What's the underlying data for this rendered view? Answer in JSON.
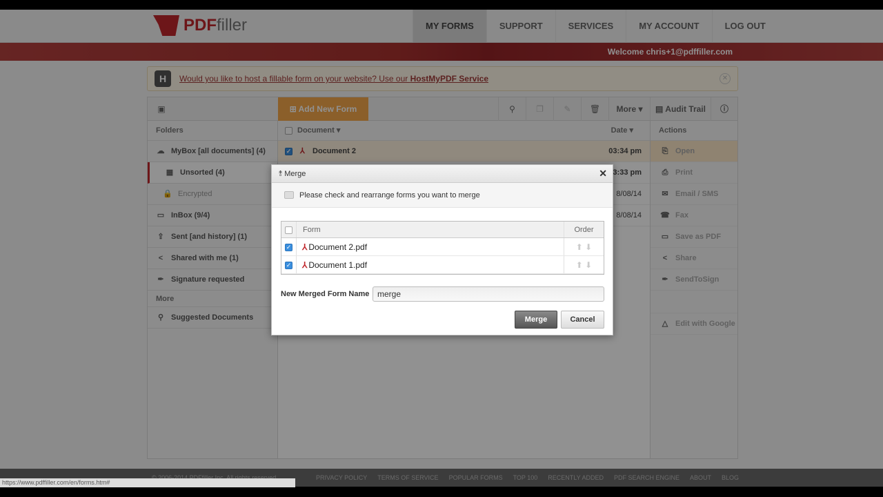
{
  "header": {
    "logo": "PDFfiller",
    "nav": [
      "MY FORMS",
      "SUPPORT",
      "SERVICES",
      "MY ACCOUNT",
      "LOG OUT"
    ],
    "welcome": "Welcome chris+1@pdffiller.com"
  },
  "banner": {
    "text": "Would you like to host a fillable form on your website? Use our ",
    "link": "HostMyPDF Service"
  },
  "toolbar": {
    "add_new_form": "Add New Form",
    "more": "More ▾",
    "audit_trail": "Audit Trail"
  },
  "sidebar": {
    "header": "Folders",
    "items": [
      "MyBox [all documents] (4)",
      "Unsorted  (4)",
      "Encrypted",
      "InBox (9/4)",
      "Sent [and history] (1)",
      "Shared with me (1)",
      "Signature requested"
    ],
    "more": "More",
    "suggested": "Suggested Documents"
  },
  "documents": {
    "col_document": "Document ▾",
    "col_date": "Date ▾",
    "rows": [
      {
        "name": "Document 2",
        "date": "03:34 pm"
      },
      {
        "name": "",
        "date": "3:33 pm"
      },
      {
        "name": "",
        "date": "8/08/14"
      },
      {
        "name": "",
        "date": "8/08/14"
      }
    ]
  },
  "actions": {
    "header": "Actions",
    "items": [
      "Open",
      "Print",
      "Email / SMS",
      "Fax",
      "Save as PDF",
      "Share",
      "SendToSign",
      "Edit with Google"
    ]
  },
  "dialog": {
    "title": "Merge",
    "instruction": "Please check and rearrange forms you want to merge",
    "col_form": "Form",
    "col_order": "Order",
    "forms": [
      {
        "name": "Document 2.pdf",
        "checked": true
      },
      {
        "name": "Document 1.pdf",
        "checked": true
      }
    ],
    "name_label": "New Merged Form Name",
    "name_value": "merge",
    "merge_button": "Merge",
    "cancel_button": "Cancel"
  },
  "footer": {
    "copyright": "© 2006-2014 PDFfiller Inc. All rights reserved",
    "links": [
      "PRIVACY POLICY",
      "TERMS OF SERVICE",
      "POPULAR FORMS",
      "TOP 100",
      "RECENTLY ADDED",
      "PDF SEARCH ENGINE",
      "ABOUT",
      "BLOG"
    ]
  },
  "status_url": "https://www.pdffiller.com/en/forms.htm#"
}
